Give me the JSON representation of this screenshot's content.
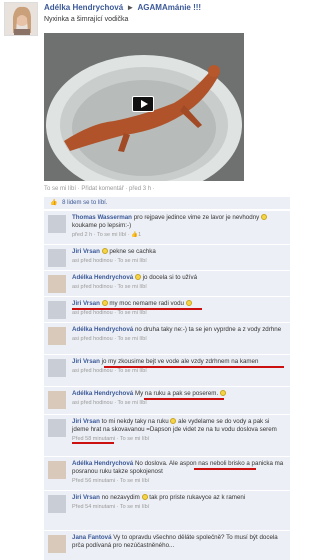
{
  "post": {
    "author": "Adélka Hendrychová",
    "arrow": "►",
    "group": "AGAMAmánie !!!",
    "text": "Nyxinka a šimrající vodička",
    "actions": "To se mi líbí · Přidat komentář · před 3 h ·"
  },
  "likes": {
    "text": "8 lidem se to líbí."
  },
  "comments": [
    {
      "author": "Thomas Wasserman",
      "text": "pro rejpave jedince vime ze lavor je nevhodny",
      "tail": "koukame po lepsim:-)",
      "meta": "před 2 h · To se mi líbí ·",
      "likes": "1"
    },
    {
      "author": "Jiri Vrsan",
      "text": "pekne se cachka",
      "meta": "asi před hodinou · To se mi líbí"
    },
    {
      "author": "Adélka Hendrychová",
      "text": "jo docela si to užívá",
      "meta": "asi před hodinou · To se mi líbí"
    },
    {
      "author": "Jiri Vrsan",
      "text": "my moc nemame radi vodu",
      "meta": "asi před hodinou · To se mi líbí"
    },
    {
      "author": "Adélka Hendrychová",
      "text": "no druha taky ne:-) ta se jen vyprdne a z vody zdrhne",
      "meta": "asi před hodinou · To se mi líbí"
    },
    {
      "author": "Jiri Vrsan",
      "text": "jo my zkousime bejt ve vode ale vzdy zdrhnem na kamen",
      "meta": "asi před hodinou · To se mi líbí"
    },
    {
      "author": "Adélka Hendrychová",
      "text": "My na ruku a pak se poserem.",
      "meta": "asi před hodinou · To se mi líbí"
    },
    {
      "author": "Jiri Vrsan",
      "text": "to mi nekdy taky na ruku",
      "text2": "ale vydelame se do vody a pak si jdeme hrat na skovavanou =Dapson jde videt ze na tu vodu doslova serem",
      "meta": "Před 58 minutami · To se mi líbí"
    },
    {
      "author": "Adélka Hendrychová",
      "text": "No doslova. Ale aspon nas neboli brisko a panicka ma posranou ruku takze spokojenost",
      "meta": "Před 56 minutami · To se mi líbí"
    },
    {
      "author": "Jiri Vrsan",
      "text": "no nezavydim",
      "text2": "tak pro priste rukavyce az k rameni",
      "meta": "Před 54 minutami · To se mi líbí"
    },
    {
      "author": "Jana Fantová",
      "text": "Vy to opravdu všechno děláte společně? To musí být docela prča podívaná pro nezúčastněného...",
      "meta": ""
    }
  ],
  "colors": {
    "link": "#3b5998",
    "comment_bg": "#eceff5",
    "underline": "#cc1010"
  },
  "icons": {
    "play": "play-icon",
    "like": "thumbs-up-icon",
    "smile": "smiley-icon"
  }
}
